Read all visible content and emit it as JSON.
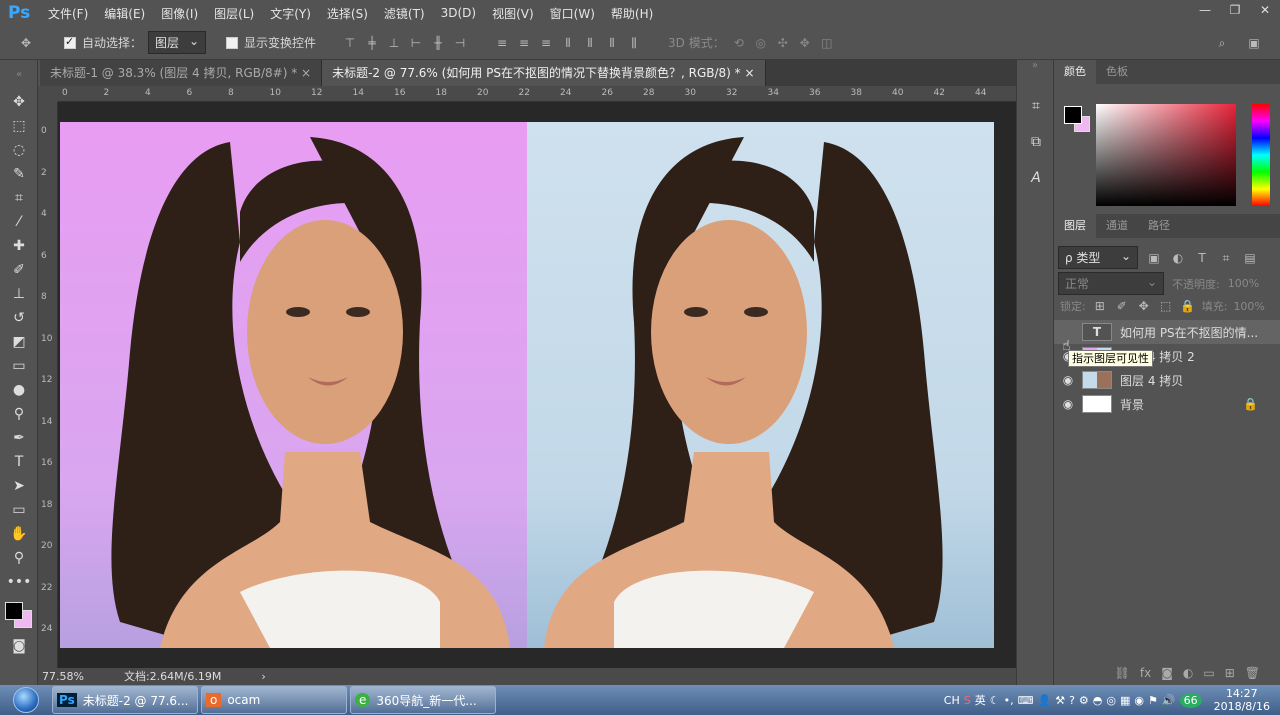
{
  "app": {
    "logo": "Ps"
  },
  "menu": [
    "文件(F)",
    "编辑(E)",
    "图像(I)",
    "图层(L)",
    "文字(Y)",
    "选择(S)",
    "滤镜(T)",
    "3D(D)",
    "视图(V)",
    "窗口(W)",
    "帮助(H)"
  ],
  "window_controls": [
    "—",
    "❐",
    "✕"
  ],
  "options": {
    "auto_select_label": "自动选择：",
    "auto_select_checked": true,
    "auto_select_value": "图层",
    "show_transform_label": "显示变换控件",
    "mode_3d_label": "3D 模式："
  },
  "tabs": [
    {
      "label": "未标题-1 @ 38.3% (图层 4 拷贝, RGB/8#) *",
      "close": "×",
      "active": false
    },
    {
      "label": "未标题-2 @ 77.6% (如何用 PS在不抠图的情况下替换背景颜色？, RGB/8) *",
      "close": "×",
      "active": true
    }
  ],
  "ruler_h": [
    "0",
    "2",
    "4",
    "6",
    "8",
    "10",
    "12",
    "14",
    "16",
    "18",
    "20",
    "22",
    "24",
    "26",
    "28",
    "30",
    "32",
    "34",
    "36",
    "38",
    "40",
    "42",
    "44"
  ],
  "ruler_v": [
    "0",
    "2",
    "4",
    "6",
    "8",
    "10",
    "12",
    "14",
    "16",
    "18",
    "20",
    "22",
    "24"
  ],
  "status": {
    "zoom": "77.58%",
    "doc": "文档:2.64M/6.19M",
    "arrow": "›"
  },
  "color_panel": {
    "tabs": [
      "颜色",
      "色板"
    ],
    "fg": "#000000",
    "bg": "#f0b8f0"
  },
  "layers_panel": {
    "tabs": [
      "图层",
      "通道",
      "路径"
    ],
    "filter_label": "ρ 类型",
    "blend_mode": "正常",
    "opacity_label": "不透明度:",
    "opacity_value": "100%",
    "lock_label": "锁定:",
    "fill_label": "填充:",
    "fill_value": "100%",
    "layers": [
      {
        "name": "如何用 PS在不抠图的情...",
        "thumb_glyph": "T",
        "visible": false,
        "type": "text"
      },
      {
        "name": "图层 4 拷贝 2",
        "visible": true,
        "type": "image"
      },
      {
        "name": "图层 4 拷贝",
        "visible": true,
        "type": "image"
      },
      {
        "name": "背景",
        "visible": true,
        "type": "background",
        "locked": true
      }
    ],
    "tooltip": "指示图层可见性"
  },
  "taskbar": {
    "items": [
      {
        "label": "未标题-2 @ 77.6...",
        "icon": "Ps"
      },
      {
        "label": "ocam",
        "icon": "o"
      },
      {
        "label": "360导航_新一代...",
        "icon": "e"
      }
    ],
    "tray": {
      "lang": "CH",
      "ime": "英",
      "badge": "66",
      "time": "14:27",
      "date": "2018/8/16"
    }
  },
  "colors": {
    "accent": "#3aa8ff"
  }
}
